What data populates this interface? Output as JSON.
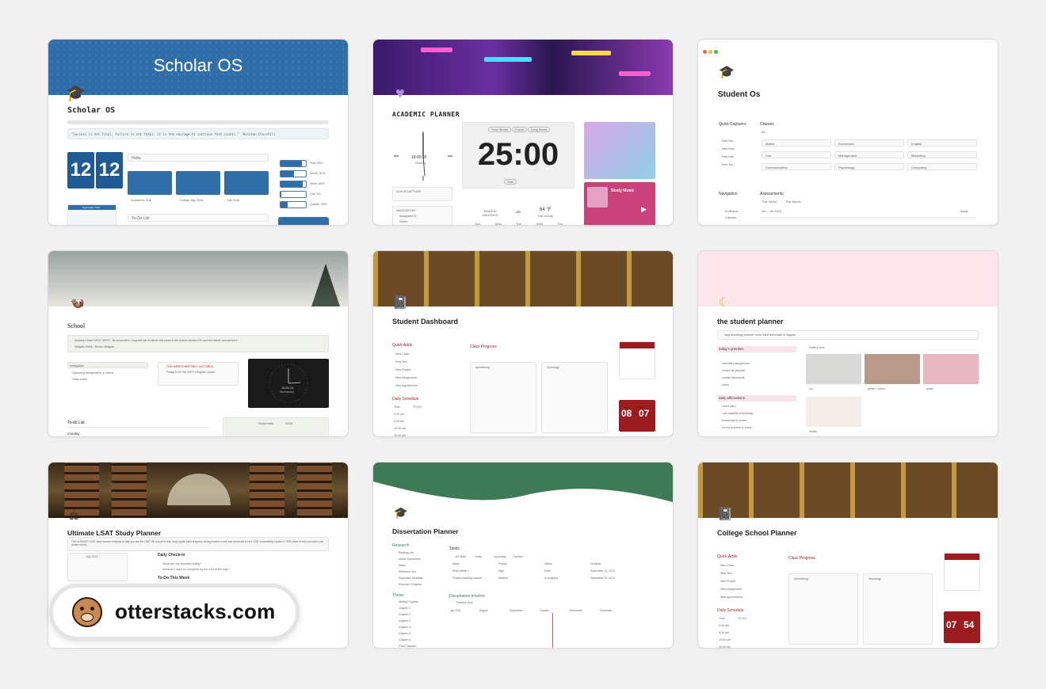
{
  "cards": {
    "scholar": {
      "banner_title": "Scholar OS",
      "title": "Scholar OS",
      "quote": "\"Success is not final, failure is not fatal: it is the courage to continue that counts.\" -Winston Churchill",
      "clock": [
        "12",
        "12"
      ],
      "hubs_label": "Hubs",
      "hub_buttons": [
        "Academic Hub",
        "College App Hub",
        "Life Hub"
      ],
      "progress": [
        {
          "label": "Year: 84%",
          "value": 0.84
        },
        {
          "label": "Month: 53%",
          "value": 0.53
        },
        {
          "label": "Week: 86%",
          "value": 0.86
        },
        {
          "label": "Day: 3%",
          "value": 0.03
        },
        {
          "label": "Quarter: 29%",
          "value": 0.29
        }
      ],
      "todo_label": "To-Do List",
      "calendar_label": "September 2024"
    },
    "academic": {
      "title": "ACADEMIC PLANNER",
      "timer": "25:00",
      "timer_tabs": [
        "Short Break",
        "Focus",
        "Long Break"
      ],
      "clock_time": "18:00:30",
      "clock_day": "Sunday",
      "quick_capture": "QUICKCAPTURE",
      "navigation": "NAVIGATION",
      "nav_items": [
        "Assignment",
        "Notes"
      ],
      "city": "MADRID",
      "weather_label": "WEATHER",
      "temp": "64 °F",
      "temp_sub": "Not cloudy",
      "days": [
        "Sun",
        "Mon",
        "Tue",
        "Wed",
        "Thu"
      ],
      "music": "Study Music",
      "start_label": "Start"
    },
    "student_os": {
      "title": "Student Os",
      "quick_captures": "Quick Captures",
      "captures": [
        "New Not...",
        "New Note",
        "New Unit",
        "New Tas..."
      ],
      "classes_label": "Classes",
      "classes_tab": "All",
      "classes": [
        "Maths",
        "Economics",
        "English",
        "Law",
        "Management",
        "Marketing",
        "Communication",
        "Psychology",
        "Computing"
      ],
      "navigation": "Navigation",
      "nav_items": [
        "Schedule",
        "Classes"
      ],
      "assessments": "Assessments",
      "assess_tabs": [
        "This Week",
        "This Month"
      ],
      "range": "Jun - Jul 2023",
      "today": "Today"
    },
    "school": {
      "title": "School",
      "notice": "Assessed Scan  GPDT  GIPPY : Be Accounted • Copy the link of sticker and paste in the custom section OR save the sticker and upload it",
      "notice2": "Widgets  Indify · Bonus Widgets",
      "navigation": "navigation",
      "nav_items": [
        "Upcoming assignments & exams",
        "Class notes"
      ],
      "weekly": "THIS WEEK'S MEETING / LECTURES",
      "weekly_sub": "Friday 10:00 PM GMT+1 English Lesson",
      "clock_time": "15:01:31",
      "clock_day": "Wednesday",
      "todo": "To-do List",
      "monday": "monday",
      "month": "September",
      "year": "2024"
    },
    "dashboard": {
      "title": "Student Dashboard",
      "quick_adds": "Quick Adds",
      "adds": [
        "New Class",
        "New Test",
        "New Project",
        "New Assignment",
        "New Appointment"
      ],
      "progress": "Class Progress",
      "classes": [
        "Advertising",
        "Sociology"
      ],
      "daily": "Daily Schedule",
      "schedule_cols": [
        "Time",
        "TO DO"
      ],
      "times": [
        "9:00 am",
        "9:30 am",
        "10:00 am",
        "10:30 am"
      ],
      "flip": [
        "08",
        "07"
      ]
    },
    "student_planner": {
      "title": "the student planner",
      "quote": "stop doubting yourself, work hard and make it happen",
      "priorities": "today's priorities",
      "priority_items": [
        "chemistry assignment",
        "review lab physics",
        "update flashcards",
        "notes"
      ],
      "gallery": "Gallery view",
      "gallery_items": [
        "run",
        "goals + vision",
        "pilate",
        "health"
      ],
      "affirmations": "daily affirmations",
      "affirmation_items": [
        "i work hard",
        "i am capable of anything",
        "knowledge is power",
        "it's my moment to shine"
      ]
    },
    "lsat": {
      "title": "Ultimate LSAT Study Planner",
      "desc": "The ULTIMATE LSAT study planner template to help you ace the LSAT! All of your to-dos, study goals, habit progress, timing practice notes, and resources for the LSAT conveniently located in ONE place to help you reach your dream school.",
      "checkin": "Daily Check-in",
      "questions": [
        "What are my priorities today?",
        "What do I want to complete by the end of the day?"
      ],
      "todo": "To-Do This Week",
      "cal": "July 2024"
    },
    "dissertation": {
      "title": "Dissertation Planner",
      "research": "Research",
      "research_items": [
        "Reading List",
        "Article Summaries",
        "Notes",
        "Reference List",
        "Supervisor Meetings",
        "Research Progress"
      ],
      "thesis": "Thesis",
      "thesis_items": [
        "Writing Progress",
        "Chapter 1",
        "Chapter 2",
        "Chapter 3",
        "Chapter 4",
        "Chapter 5",
        "Chapter 6",
        "Final Checklist"
      ],
      "tasks": "Tasks",
      "task_tabs": [
        "All Tasks",
        "Today",
        "Upcoming",
        "Overdue"
      ],
      "task_cols": [
        "Name",
        "Priority",
        "Status",
        "Deadline"
      ],
      "task_rows": [
        {
          "name": "Read Article 1",
          "priority": "High",
          "status": "Done",
          "deadline": "September 13, 2024"
        },
        {
          "name": "Finalise meeting minutes",
          "priority": "Medium",
          "status": "In progress",
          "deadline": "September 29, 2024"
        }
      ],
      "timeline": "Dissertation timeline",
      "timeline_view": "Timeline view",
      "months": [
        "July 2024",
        "August",
        "September",
        "October",
        "November",
        "December"
      ]
    },
    "college": {
      "title": "College School Planner",
      "quick_adds": "Quick Adds",
      "adds": [
        "New Class",
        "New Test",
        "New Project",
        "New Assignment",
        "New Appointment"
      ],
      "progress": "Class Progress",
      "classes": [
        "Advertising",
        "Sociology"
      ],
      "daily": "Daily Schedule",
      "schedule_cols": [
        "Time",
        "TO DO"
      ],
      "times": [
        "9:00 am",
        "9:30 am",
        "10:00 am",
        "10:30 am"
      ],
      "flip": [
        "07",
        "54"
      ]
    }
  },
  "watermark": "otterstacks.com",
  "colors": {
    "scholar_blue": "#2f6ea8",
    "dashboard_red": "#9b1b1e",
    "dissertation_green": "#3e7a55",
    "planner_pink": "#fbe5ea"
  }
}
